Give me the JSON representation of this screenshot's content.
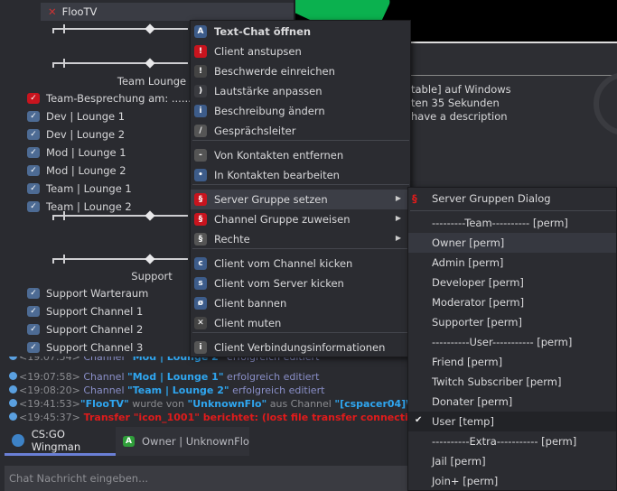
{
  "tree": {
    "client_name": "FlooTV",
    "spacers": [
      "Team Lounge",
      "Support"
    ],
    "channels_team": [
      "Team-Besprechung am: .......",
      "Dev | Lounge 1",
      "Dev | Lounge 2",
      "Mod | Lounge 1",
      "Mod | Lounge 2",
      "Team | Lounge 1",
      "Team | Lounge 2"
    ],
    "channels_support": [
      "Support Warteraum",
      "Support Channel 1",
      "Support Channel 2",
      "Support Channel 3"
    ]
  },
  "info_panel": {
    "title_fragment": "V]",
    "lines": [
      "table] auf Windows",
      "ten 35 Sekunden",
      "have a description"
    ]
  },
  "context_menu": {
    "items": [
      "Text-Chat öffnen",
      "Client anstupsen",
      "Beschwerde einreichen",
      "Lautstärke anpassen",
      "Beschreibung ändern",
      "Gesprächsleiter",
      "Von Kontakten entfernen",
      "In Kontakten bearbeiten",
      "Server Gruppe setzen",
      "Channel Gruppe zuweisen",
      "Rechte",
      "Client vom Channel kicken",
      "Client vom Server kicken",
      "Client bannen",
      "Client muten",
      "Client Verbindungsinformationen"
    ]
  },
  "submenu": {
    "dialog": "Server Gruppen Dialog",
    "groups": [
      "---------Team---------- [perm]",
      "Owner [perm]",
      "Admin [perm]",
      "Developer [perm]",
      "Moderator [perm]",
      "Supporter [perm]",
      "----------User----------- [perm]",
      "Friend [perm]",
      "Twitch Subscriber [perm]",
      "Donater [perm]",
      "User [temp]",
      "----------Extra----------- [perm]",
      "Jail [perm]",
      "Join+ [perm]"
    ],
    "checked": "User [temp]",
    "check_mark": "✔"
  },
  "log": [
    {
      "ts": "<19:07:54>",
      "a": " Channel ",
      "b": "\"Mod | Lounge 2\"",
      "c": " erfolgreich editiert"
    },
    {
      "ts": "<19:07:58>",
      "a": " Channel ",
      "b": "\"Mod | Lounge 1\"",
      "c": " erfolgreich editiert"
    },
    {
      "ts": "<19:08:20>",
      "a": " Channel ",
      "b": "\"Team | Lounge 2\"",
      "c": " erfolgreich editiert"
    },
    {
      "ts": "<19:41:53>",
      "b1": "\"FlooTV\"",
      "g1": " wurde von ",
      "b2": "\"UnknownFlo\"",
      "g2": " aus Channel ",
      "b3": "\"[cspacer04]Willkon"
    },
    {
      "ts": "<19:45:37>",
      "r": " Transfer \"icon_1001\" berichtet: (lost file transfer connection)"
    }
  ],
  "tabs": [
    "CS:GO Wingman",
    "Owner | UnknownFlo"
  ],
  "chat": {
    "placeholder": "Chat Nachricht eingeben..."
  },
  "colors": {
    "accent": "#6a7fd6",
    "link": "#2fa6f0",
    "error": "#e01b1b"
  }
}
